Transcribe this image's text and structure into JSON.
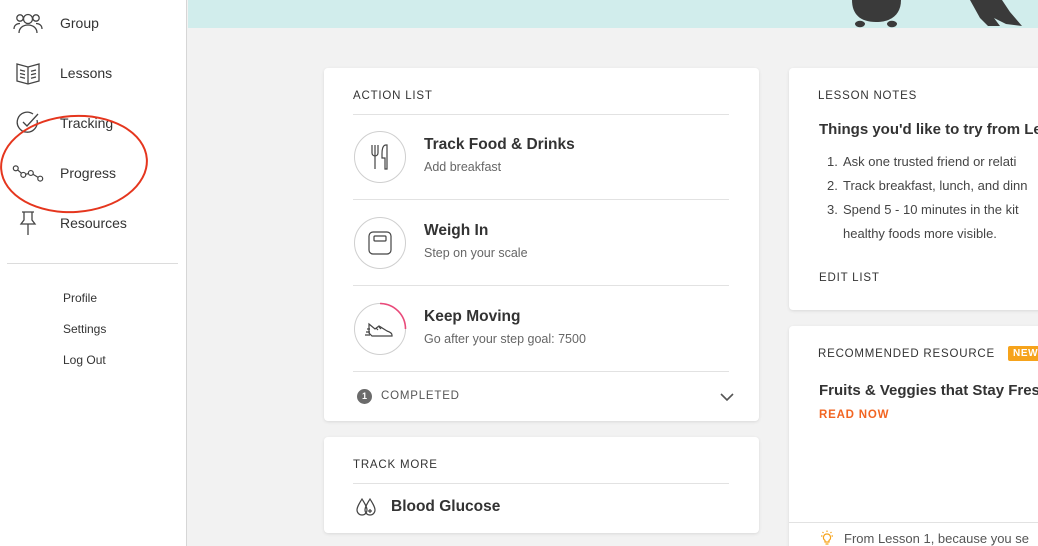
{
  "sidebar": {
    "nav": [
      {
        "label": "Group",
        "icon": "group-icon"
      },
      {
        "label": "Lessons",
        "icon": "book-icon"
      },
      {
        "label": "Tracking",
        "icon": "check-icon"
      },
      {
        "label": "Progress",
        "icon": "progress-chart-icon"
      },
      {
        "label": "Resources",
        "icon": "pin-icon"
      }
    ],
    "links": [
      "Profile",
      "Settings",
      "Log Out"
    ]
  },
  "action_list": {
    "heading": "ACTION LIST",
    "items": [
      {
        "title": "Track Food & Drinks",
        "subtitle": "Add breakfast",
        "icon": "fork-knife-icon"
      },
      {
        "title": "Weigh In",
        "subtitle": "Step on your scale",
        "icon": "scale-icon"
      },
      {
        "title": "Keep Moving",
        "subtitle": "Go after your step goal: 7500",
        "icon": "sneaker-icon"
      }
    ],
    "completed_count": "1",
    "completed_label": "COMPLETED"
  },
  "track_more": {
    "heading": "TRACK MORE",
    "item": "Blood Glucose"
  },
  "lesson_notes": {
    "heading": "LESSON NOTES",
    "title": "Things you'd like to try from Le",
    "items": [
      "Ask one trusted friend or relati",
      "Track breakfast, lunch, and dinn",
      "Spend 5 - 10 minutes in the kit"
    ],
    "item3_cont": "healthy foods more visible.",
    "edit_label": "EDIT LIST"
  },
  "recommended": {
    "heading": "RECOMMENDED RESOURCE",
    "badge": "NEW",
    "title": "Fruits & Veggies that Stay Fres",
    "read_now": "READ NOW",
    "footer": "From Lesson 1, because you se"
  },
  "colors": {
    "accent_orange": "#f26522",
    "badge_yellow": "#f6a31b",
    "banner_teal": "#d1edec",
    "highlight_red": "#e5361e",
    "progress_pink": "#e94a7a"
  }
}
